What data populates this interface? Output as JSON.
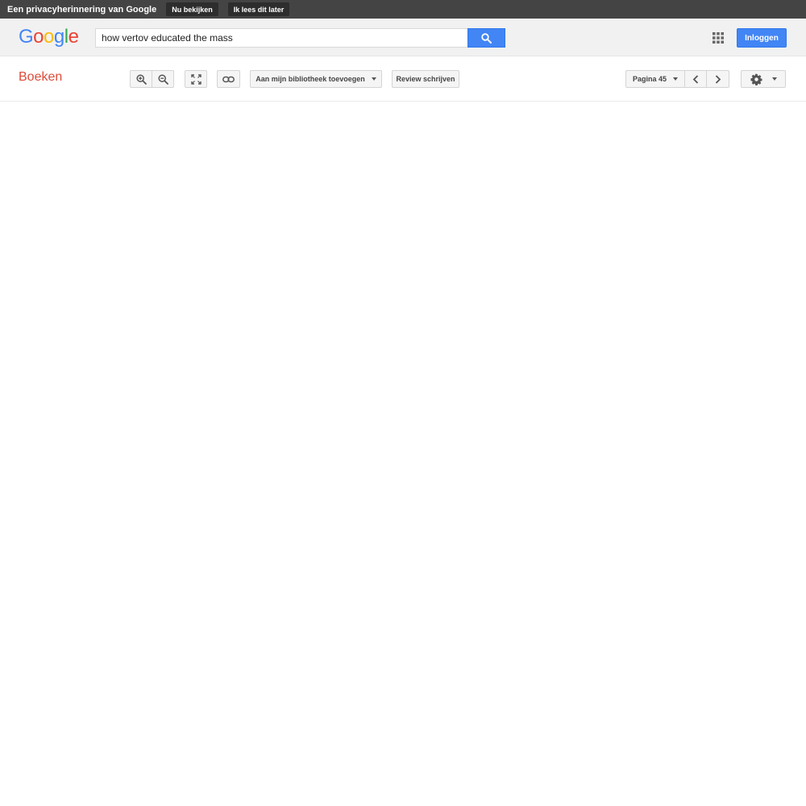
{
  "privacy_banner": {
    "title": "Een privacyherinnering van Google",
    "review_now_label": "Nu bekijken",
    "read_later_label": "Ik lees dit later"
  },
  "header": {
    "logo_letters": [
      "G",
      "o",
      "o",
      "g",
      "l",
      "e"
    ],
    "search": {
      "value": "how vertov educated the mass"
    },
    "search_icon": "search-icon",
    "apps_icon": "apps-grid-icon",
    "signin_label": "Inloggen"
  },
  "toolbar": {
    "section_title": "Boeken",
    "zoom_in_icon": "zoom-in-icon",
    "zoom_out_icon": "zoom-out-icon",
    "fullscreen_icon": "fullscreen-icon",
    "link_icon": "link-icon",
    "add_to_library_label": "Aan mijn bibliotheek toevoegen",
    "write_review_label": "Review schrijven",
    "page_label": "Pagina 45",
    "prev_icon": "chevron-left-icon",
    "next_icon": "chevron-right-icon",
    "settings_icon": "gear-icon"
  },
  "colors": {
    "banner_bg": "#444444",
    "accent_blue": "#4285f4",
    "section_red": "#dd4b39",
    "logo_blue": "#4285f4",
    "logo_red": "#ea4335",
    "logo_yellow": "#fbbc05",
    "logo_green": "#34a853"
  }
}
